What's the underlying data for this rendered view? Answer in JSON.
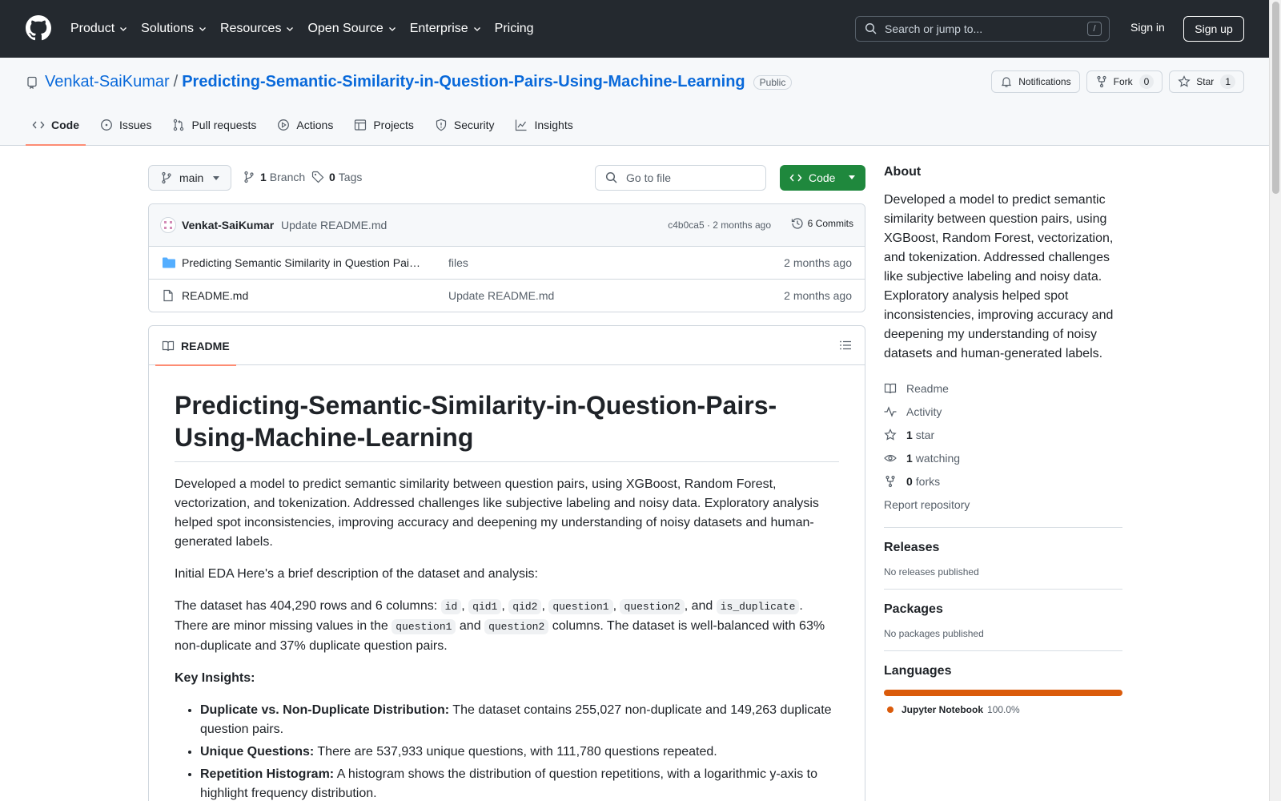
{
  "header": {
    "nav": [
      "Product",
      "Solutions",
      "Resources",
      "Open Source",
      "Enterprise",
      "Pricing"
    ],
    "search_placeholder": "Search or jump to...",
    "search_shortcut": "/",
    "signin": "Sign in",
    "signup": "Sign up"
  },
  "repo": {
    "owner": "Venkat-SaiKumar",
    "separator": "/",
    "name": "Predicting-Semantic-Similarity-in-Question-Pairs-Using-Machine-Learning",
    "visibility": "Public",
    "notifications_label": "Notifications",
    "fork_label": "Fork",
    "fork_count": "0",
    "star_label": "Star",
    "star_count": "1"
  },
  "tabs": [
    "Code",
    "Issues",
    "Pull requests",
    "Actions",
    "Projects",
    "Security",
    "Insights"
  ],
  "branchbar": {
    "branch": "main",
    "branch_count": "1",
    "branch_label": "Branch",
    "tag_count": "0",
    "tag_label": "Tags",
    "goto_placeholder": "Go to file",
    "code_button": "Code"
  },
  "commit": {
    "author": "Venkat-SaiKumar",
    "message": "Update README.md",
    "hash_time": "c4b0ca5 · 2 months ago",
    "commits_label": "6 Commits"
  },
  "files": [
    {
      "name": "Predicting Semantic Similarity in Question Pairs Using Machine Learning",
      "message": "files",
      "date": "2 months ago",
      "type": "folder"
    },
    {
      "name": "README.md",
      "message": "Update README.md",
      "date": "2 months ago",
      "type": "file"
    }
  ],
  "readme": {
    "tab": "README",
    "title": "Predicting-Semantic-Similarity-in-Question-Pairs-Using-Machine-Learning",
    "intro": "Developed a model to predict semantic similarity between question pairs, using XGBoost, Random Forest, vectorization, and tokenization. Addressed challenges like subjective labeling and noisy data. Exploratory analysis helped spot inconsistencies, improving accuracy and deepening my understanding of noisy datasets and human-generated labels.",
    "eda": "Initial EDA Here's a brief description of the dataset and analysis:",
    "dataset_prefix": "The dataset has 404,290 rows and 6 columns:",
    "columns": [
      "id",
      "qid1",
      "qid2",
      "question1",
      "question2",
      "is_duplicate"
    ],
    "and_word": "and",
    "missing_prefix": "There are minor missing values in the",
    "missing_suffix": "columns. The dataset is well-balanced with 63% non-duplicate and 37% duplicate question pairs.",
    "key_insights": "Key Insights:",
    "bullets": [
      {
        "bold": "Duplicate vs. Non-Duplicate Distribution:",
        "text": "The dataset contains 255,027 non-duplicate and 149,263 duplicate question pairs."
      },
      {
        "bold": "Unique Questions:",
        "text": "There are 537,933 unique questions, with 111,780 questions repeated."
      },
      {
        "bold": "Repetition Histogram:",
        "text": "A histogram shows the distribution of question repetitions, with a logarithmic y-axis to highlight frequency distribution."
      }
    ]
  },
  "sidebar": {
    "about_title": "About",
    "about_text": "Developed a model to predict semantic similarity between question pairs, using XGBoost, Random Forest, vectorization, and tokenization. Addressed challenges like subjective labeling and noisy data. Exploratory analysis helped spot inconsistencies, improving accuracy and deepening my understanding of noisy datasets and human-generated labels.",
    "readme": "Readme",
    "activity": "Activity",
    "stars_count": "1",
    "stars_label": "star",
    "watching_count": "1",
    "watching_label": "watching",
    "forks_count": "0",
    "forks_label": "forks",
    "report": "Report repository",
    "releases_title": "Releases",
    "releases_text": "No releases published",
    "packages_title": "Packages",
    "packages_text": "No packages published",
    "languages_title": "Languages",
    "language_name": "Jupyter Notebook",
    "language_pct": "100.0%"
  },
  "colors": {
    "header_bg": "#24292f",
    "link": "#0969da",
    "primary_button": "#1f883d",
    "active_tab": "#fd8c73",
    "language": "#da5b0b"
  }
}
